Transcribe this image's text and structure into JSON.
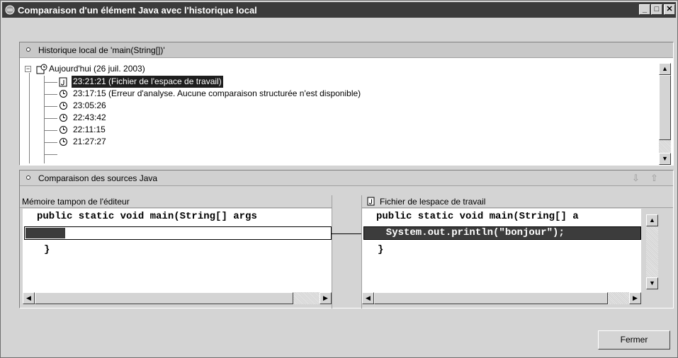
{
  "window": {
    "title": "Comparaison d'un élément Java avec l'historique local"
  },
  "history": {
    "header": "Historique local de 'main(String[])'",
    "root_label": "Aujourd'hui (26 juil. 2003)",
    "items": [
      {
        "label": "23:21:21 (Fichier de l'espace de travail)",
        "icon": "java-file-icon",
        "selected": true
      },
      {
        "label": "23:17:15 (Erreur d'analyse. Aucune comparaison structurée n'est disponible)",
        "icon": "clock-icon",
        "selected": false
      },
      {
        "label": "23:05:26",
        "icon": "clock-icon",
        "selected": false
      },
      {
        "label": "22:43:42",
        "icon": "clock-icon",
        "selected": false
      },
      {
        "label": "22:11:15",
        "icon": "clock-icon",
        "selected": false
      },
      {
        "label": "21:27:27",
        "icon": "clock-icon",
        "selected": false
      }
    ]
  },
  "compare": {
    "header": "Comparaison des sources Java",
    "left": {
      "title": "Mémoire tampon de l'éditeur",
      "lines": [
        "public static void main(String[] args",
        "",
        "}"
      ]
    },
    "right": {
      "title": "Fichier de lespace de travail",
      "lines": [
        "public static void main(String[] a",
        "  System.out.println(\"bonjour\");",
        "}"
      ]
    }
  },
  "buttons": {
    "close": "Fermer"
  },
  "colors": {
    "titlebar": "#3b3b3b",
    "selection": "#1e1e1e",
    "face": "#d4d4d4"
  }
}
